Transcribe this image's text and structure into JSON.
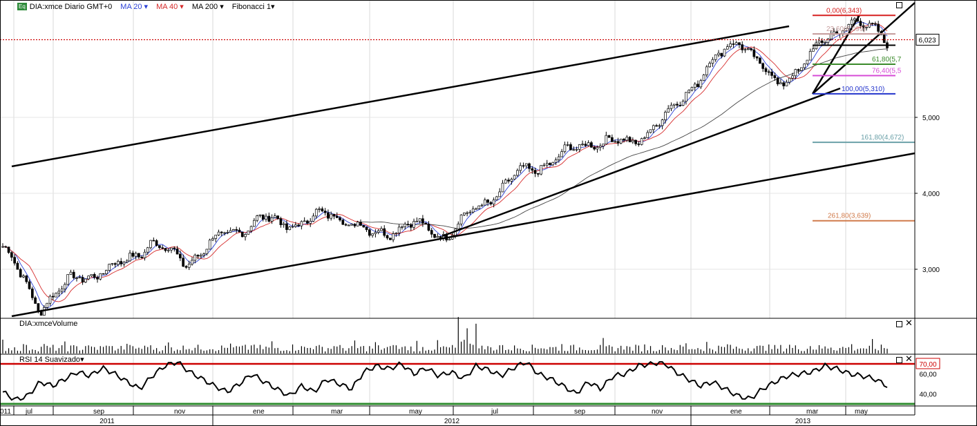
{
  "header": {
    "badge": "Eq",
    "instrument": "DIA:xmce Diario GMT+0",
    "ma20": "MA 20",
    "ma40": "MA 40",
    "ma200": "MA 200",
    "fibo": "Fibonacci 1"
  },
  "panels": {
    "volume_title": "DIA:xmceVolume",
    "rsi_title": "RSI 14 Suavizado"
  },
  "colors": {
    "price_candles": "#000000",
    "ma20": "#2a3fd6",
    "ma40": "#d62a2a",
    "ma200": "#444444",
    "rsi_upper": "#cc0000",
    "rsi_lower": "#2e8b2e",
    "last_price_line": "#cc0000"
  },
  "last_price": "6,023",
  "chart_data": {
    "type": "candlestick",
    "price_axis": {
      "ticks": [
        "3,000",
        "4,000",
        "5,000"
      ],
      "ylim": [
        2.4,
        6.5
      ]
    },
    "time_axis": {
      "months": [
        "011",
        "jul",
        "sep",
        "nov",
        "ene",
        "mar",
        "may",
        "jul",
        "sep",
        "nov",
        "ene",
        "mar",
        "may"
      ],
      "years": [
        "2011",
        "2012",
        "2013"
      ]
    },
    "price_series": [
      [
        "2011-06",
        3.3
      ],
      [
        "2011-07",
        2.5
      ],
      [
        "2011-08",
        2.9
      ],
      [
        "2011-09",
        3.0
      ],
      [
        "2011-10",
        3.35
      ],
      [
        "2011-11",
        3.1
      ],
      [
        "2011-12",
        3.45
      ],
      [
        "2012-01",
        3.65
      ],
      [
        "2012-02",
        3.6
      ],
      [
        "2012-03",
        3.75
      ],
      [
        "2012-04",
        3.45
      ],
      [
        "2012-05",
        3.6
      ],
      [
        "2012-06",
        3.45
      ],
      [
        "2012-07",
        3.85
      ],
      [
        "2012-08",
        4.25
      ],
      [
        "2012-09",
        4.45
      ],
      [
        "2012-10",
        4.7
      ],
      [
        "2012-11",
        4.65
      ],
      [
        "2012-12",
        5.0
      ],
      [
        "2013-01",
        5.6
      ],
      [
        "2013-02",
        6.05
      ],
      [
        "2013-03",
        5.4
      ],
      [
        "2013-04",
        5.85
      ],
      [
        "2013-05",
        6.3
      ],
      [
        "2013-06",
        6.02
      ]
    ],
    "fibonacci": [
      {
        "label": "0,00(6,343)",
        "value": 6.343,
        "color": "#d61e1e"
      },
      {
        "label": "23,60(6,099)",
        "value": 6.099,
        "color": "#c49a9a"
      },
      {
        "label": "61,80(5,7",
        "value": 5.7,
        "color": "#3a8a2a"
      },
      {
        "label": "76,40(5,5",
        "value": 5.55,
        "color": "#d64bd6"
      },
      {
        "label": "100,00(5,310)",
        "value": 5.31,
        "color": "#2233cc"
      },
      {
        "label": "161,80(4,672)",
        "value": 4.672,
        "color": "#6aa0a8"
      },
      {
        "label": "261,80(3,639)",
        "value": 3.639,
        "color": "#d07a4a"
      }
    ],
    "rsi": {
      "ticks": [
        "70,00",
        "60,00",
        "40,00"
      ],
      "ylim": [
        30,
        75
      ],
      "upper_level": 70,
      "lower_level": 30,
      "values": [
        42,
        34,
        38,
        52,
        48,
        55,
        62,
        58,
        66,
        60,
        52,
        45,
        58,
        68,
        72,
        62,
        55,
        48,
        42,
        50,
        60,
        52,
        45,
        38,
        48,
        42,
        55,
        50,
        45,
        62,
        68,
        65,
        70,
        60,
        66,
        58,
        62,
        55,
        68,
        64,
        58,
        66,
        72,
        60,
        55,
        48,
        40,
        52,
        45,
        58,
        60,
        68,
        70,
        72,
        62,
        55,
        48,
        52,
        45,
        38,
        35,
        45,
        52,
        58,
        60,
        62,
        68,
        65,
        60,
        58,
        55,
        48
      ]
    }
  }
}
